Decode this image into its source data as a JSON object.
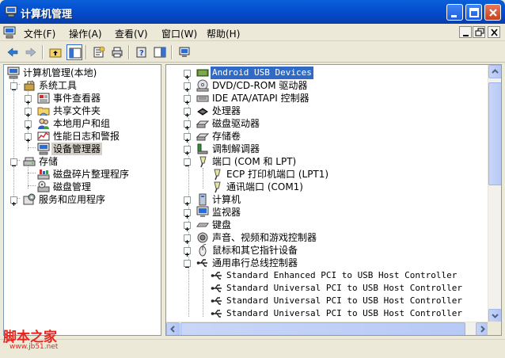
{
  "window": {
    "title": "计算机管理"
  },
  "menu": {
    "items": [
      {
        "label": "文件(F)"
      },
      {
        "label": "操作(A)"
      },
      {
        "label": "查看(V)"
      },
      {
        "label": "窗口(W)"
      },
      {
        "label": "帮助(H)"
      }
    ]
  },
  "left_tree": {
    "root": "计算机管理(本地)",
    "system_tools": "系统工具",
    "event_viewer": "事件查看器",
    "shared_folders": "共享文件夹",
    "local_users": "本地用户和组",
    "perf_logs": "性能日志和警报",
    "device_manager": "设备管理器",
    "storage": "存储",
    "defrag": "磁盘碎片整理程序",
    "disk_mgmt": "磁盘管理",
    "services": "服务和应用程序"
  },
  "right_tree": {
    "android": "Android USB Devices",
    "dvd": "DVD/CD-ROM 驱动器",
    "ide": "IDE ATA/ATAPI 控制器",
    "cpu": "处理器",
    "disk": "磁盘驱动器",
    "volumes": "存储卷",
    "modem": "调制解调器",
    "ports": "端口 (COM 和 LPT)",
    "ecp": "ECP 打印机端口 (LPT1)",
    "com1": "通讯端口 (COM1)",
    "computer": "计算机",
    "monitor": "监视器",
    "keyboard": "键盘",
    "sound": "声音、视频和游戏控制器",
    "mouse": "鼠标和其它指针设备",
    "usb": "通用串行总线控制器",
    "usb_items": [
      "Standard Enhanced PCI to USB Host Controller",
      "Standard Universal PCI to USB Host Controller",
      "Standard Universal PCI to USB Host Controller",
      "Standard Universal PCI to USB Host Controller"
    ]
  },
  "watermark": {
    "text": "脚本之家",
    "url": "www.jb51.net"
  },
  "colors": {
    "titlebar": "#0450d0",
    "selection": "#316ac5"
  }
}
